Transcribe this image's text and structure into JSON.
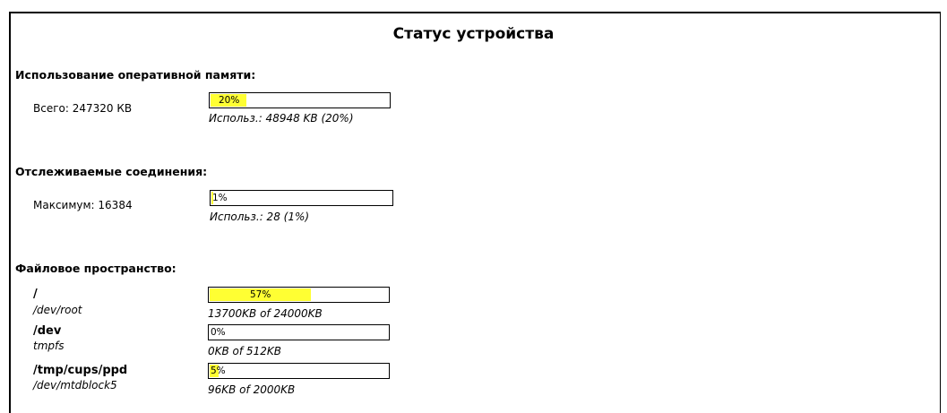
{
  "page": {
    "title": "Статус устройства"
  },
  "ram": {
    "heading": "Использование оперативной памяти:",
    "total": "Всего: 247320 КВ",
    "percent_label": "20%",
    "percent": 0.2,
    "usage": "Использ.: 48948 KB (20%)"
  },
  "conn": {
    "heading": "Отслеживаемые соединения:",
    "max": "Максимум: 16384",
    "percent_label": "1%",
    "percent": 0.01,
    "usage": "Использ.: 28 (1%)"
  },
  "fs": {
    "heading": "Файловое пространство:",
    "items": [
      {
        "name": "/",
        "device": "/dev/root",
        "percent_label": "57%",
        "percent": 0.57,
        "usage": "13700KB of 24000KB"
      },
      {
        "name": "/dev",
        "device": "tmpfs",
        "percent_label": "0%",
        "percent": 0.0,
        "usage": "0KB of 512KB"
      },
      {
        "name": "/tmp/cups/ppd",
        "device": "/dev/mtdblock5",
        "percent_label": "5%",
        "percent": 0.05,
        "usage": "96KB of 2000KB"
      }
    ]
  },
  "colors": {
    "bar_fill": "#ffff33"
  }
}
